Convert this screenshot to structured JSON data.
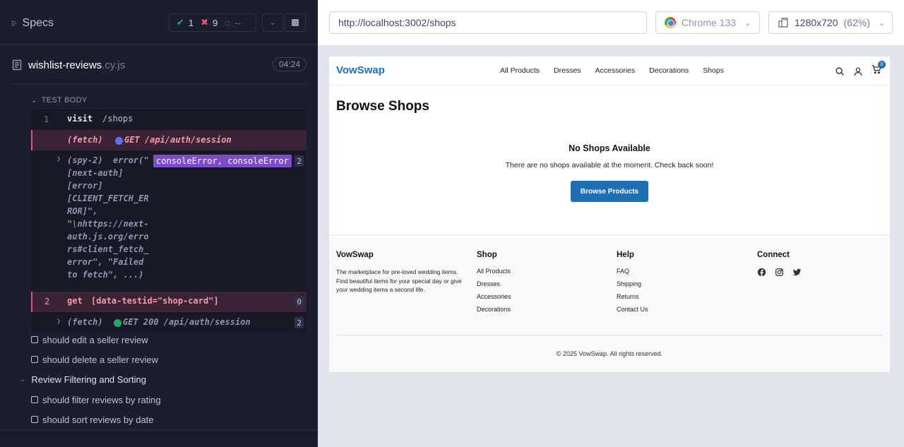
{
  "reporter": {
    "specs_label": "Specs",
    "stats": {
      "passed": "1",
      "failed": "9",
      "pending": "--"
    },
    "spec": {
      "name": "wishlist-reviews",
      "ext": ".cy.js",
      "time": "04:24"
    },
    "test_body_label": "TEST BODY",
    "commands": {
      "visit": {
        "num": "1",
        "name": "visit",
        "message": "/shops"
      },
      "fetch1": {
        "name": "(fetch)",
        "message": "GET /api/auth/session"
      },
      "spy": {
        "text": "(spy-2)  error(\"\n[next-auth]\n[error]\n[CLIENT_FETCH_ER\nROR]\",\n\"\\nhttps://next-\nauth.js.org/erro\nrs#client_fetch_\nerror\", \"Failed\nto fetch\", ...)",
        "alias": "consoleError, consoleError",
        "count": "2"
      },
      "get": {
        "num": "2",
        "name": "get",
        "message": "[data-testid=\"shop-card\"]",
        "count": "0"
      },
      "fetch2": {
        "name": "(fetch)",
        "message": "GET 200 /api/auth/session",
        "count": "2"
      }
    },
    "tests": [
      "should edit a seller review",
      "should delete a seller review"
    ],
    "suite": "Review Filtering and Sorting",
    "suite_tests": [
      "should filter reviews by rating",
      "should sort reviews by date"
    ]
  },
  "runner": {
    "url": "http://localhost:3002/shops",
    "browser": "Chrome 133",
    "viewport": "1280x720",
    "zoom": "(62%)"
  },
  "site": {
    "logo": "VowSwap",
    "nav": [
      "All Products",
      "Dresses",
      "Accessories",
      "Decorations",
      "Shops"
    ],
    "cart_count": "0",
    "page_title": "Browse Shops",
    "empty_title": "No Shops Available",
    "empty_desc": "There are no shops available at the moment. Check back soon!",
    "browse_button": "Browse Products",
    "footer": {
      "brand": "VowSwap",
      "brand_text": "The marketplace for pre-loved wedding items. Find beautiful items for your special day or give your wedding items a second life.",
      "shop_head": "Shop",
      "shop_links": [
        "All Products",
        "Dresses",
        "Accessories",
        "Decorations"
      ],
      "help_head": "Help",
      "help_links": [
        "FAQ",
        "Shipping",
        "Returns",
        "Contact Us"
      ],
      "connect_head": "Connect",
      "copyright": "© 2025 VowSwap. All rights reserved."
    }
  },
  "colors": {
    "reporter_bg": "#1b1e2e",
    "fail": "#e45770",
    "pass": "#1fa971",
    "alias": "#7e4dc6",
    "brand": "#1f6fb7"
  }
}
